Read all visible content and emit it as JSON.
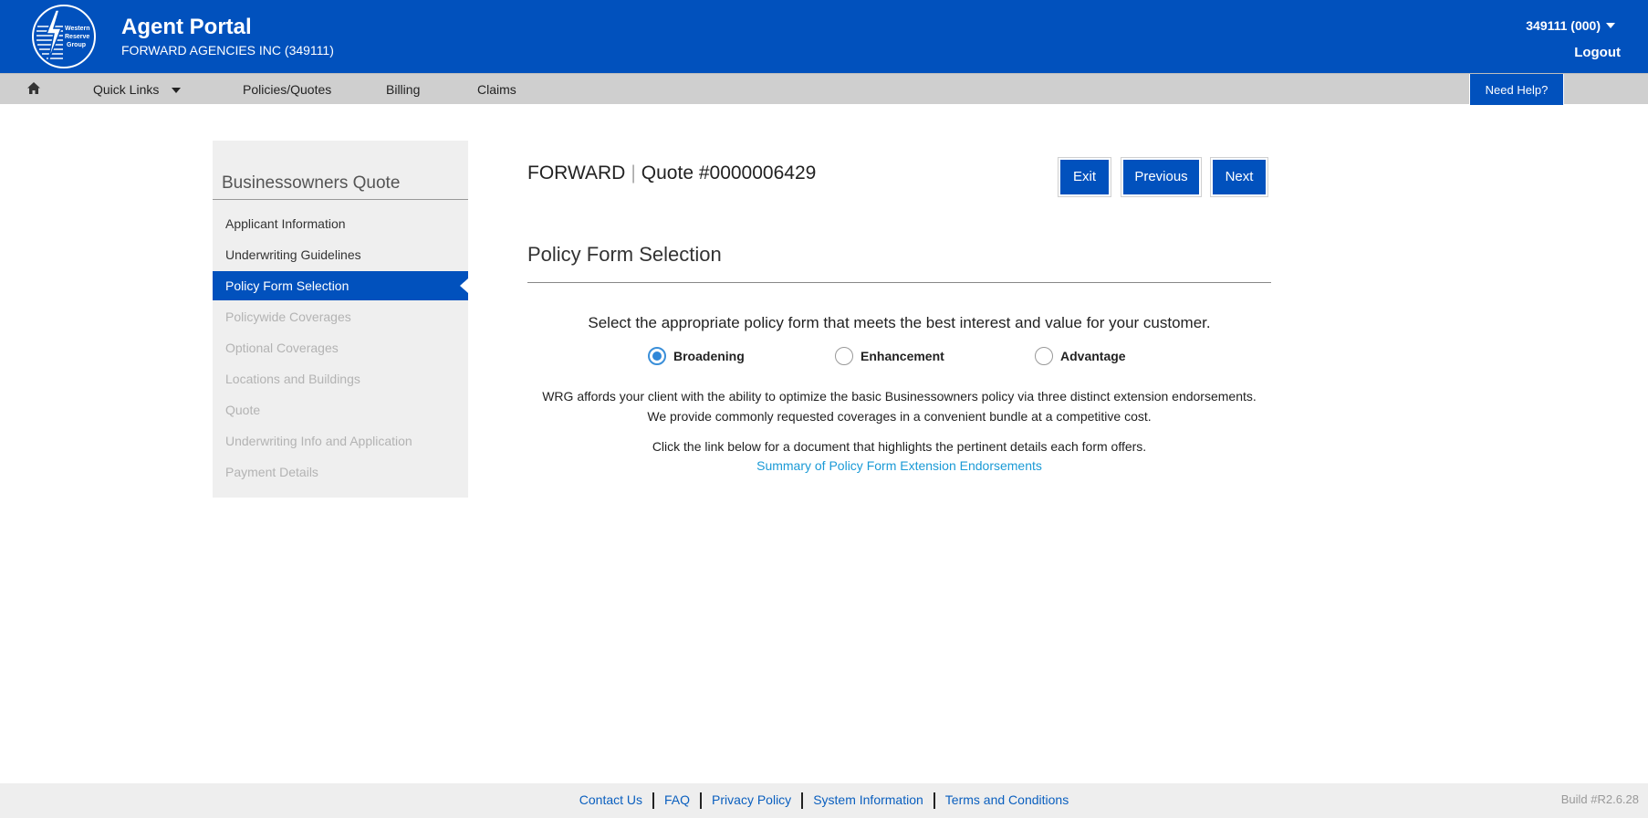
{
  "header": {
    "title": "Agent Portal",
    "agency": "FORWARD AGENCIES INC (349111)",
    "account": "349111 (000)",
    "logout": "Logout",
    "logo_text": [
      "Western",
      "Reserve",
      "Group"
    ]
  },
  "nav": {
    "home_icon": "home-icon",
    "items": [
      "Quick Links",
      "Policies/Quotes",
      "Billing",
      "Claims"
    ],
    "help": "Need Help?"
  },
  "sidebar": {
    "title": "Businessowners Quote",
    "items": [
      {
        "label": "Applicant Information",
        "state": "enabled"
      },
      {
        "label": "Underwriting Guidelines",
        "state": "enabled"
      },
      {
        "label": "Policy Form Selection",
        "state": "active"
      },
      {
        "label": "Policywide Coverages",
        "state": "disabled"
      },
      {
        "label": "Optional Coverages",
        "state": "disabled"
      },
      {
        "label": "Locations and Buildings",
        "state": "disabled"
      },
      {
        "label": "Quote",
        "state": "disabled"
      },
      {
        "label": "Underwriting Info and Application",
        "state": "disabled"
      },
      {
        "label": "Payment Details",
        "state": "disabled"
      }
    ]
  },
  "main": {
    "client": "FORWARD",
    "quote": "Quote #0000006429",
    "buttons": {
      "exit": "Exit",
      "previous": "Previous",
      "next": "Next"
    },
    "section_title": "Policy Form Selection",
    "instruction": "Select the appropriate policy form that meets the best interest and value for your customer.",
    "options": [
      {
        "label": "Broadening",
        "checked": true
      },
      {
        "label": "Enhancement",
        "checked": false
      },
      {
        "label": "Advantage",
        "checked": false
      }
    ],
    "desc_line1": "WRG affords your client with the ability to optimize the basic Businessowners policy via three distinct extension endorsements.",
    "desc_line2": "We provide commonly requested coverages in a convenient bundle at a competitive cost.",
    "desc_line3": "Click the link below for a document that highlights the pertinent details each form offers.",
    "link": "Summary of Policy Form Extension Endorsements"
  },
  "footer": {
    "links": [
      "Contact Us",
      "FAQ",
      "Privacy Policy",
      "System Information",
      "Terms and Conditions"
    ],
    "build": "Build #R2.6.28"
  },
  "colors": {
    "brand_blue": "#0151bd",
    "link_blue": "#1a9ad6",
    "nav_gray": "#cfcfcf"
  }
}
